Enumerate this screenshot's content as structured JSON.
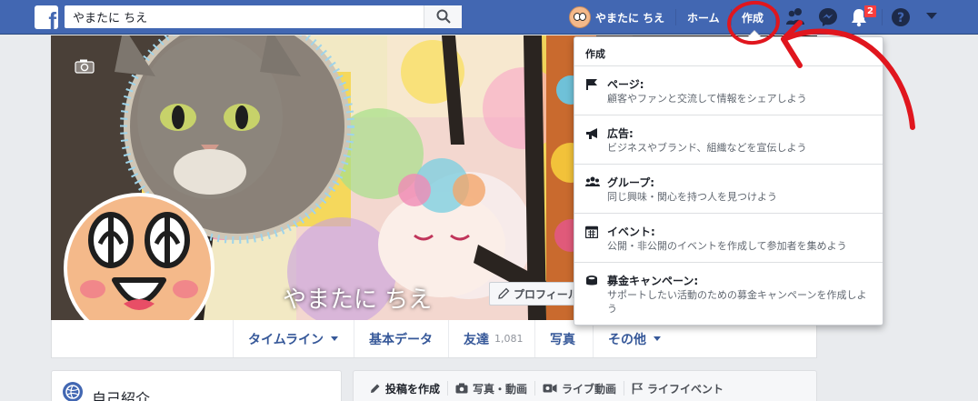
{
  "topbar": {
    "logo": "f",
    "search_value": "やまたに ちえ",
    "user_name": "やまたに ちえ",
    "nav_home": "ホーム",
    "nav_create": "作成",
    "notification_count": "2",
    "icons": [
      "search-icon",
      "friends-icon",
      "messenger-icon",
      "bell-icon",
      "help-icon",
      "caret-down-icon"
    ]
  },
  "profile": {
    "cover_name": "やまたに ちえ",
    "edit_profile_label": "プロフィールを編集"
  },
  "tabs": [
    {
      "label": "タイムライン",
      "has_caret": true
    },
    {
      "label": "基本データ"
    },
    {
      "label": "友達",
      "count": "1,081"
    },
    {
      "label": "写真"
    },
    {
      "label": "その他",
      "has_caret": true
    }
  ],
  "intro": {
    "title": "自己紹介"
  },
  "composer": {
    "items": [
      "投稿を作成",
      "写真・動画",
      "ライブ動画",
      "ライフイベント"
    ]
  },
  "create_menu": {
    "header": "作成",
    "items": [
      {
        "title": "ページ:",
        "desc": "顧客やファンと交流して情報をシェアしよう",
        "icon": "flag-icon"
      },
      {
        "title": "広告:",
        "desc": "ビジネスやブランド、組織などを宣伝しよう",
        "icon": "megaphone-icon"
      },
      {
        "title": "グループ:",
        "desc": "同じ興味・関心を持つ人を見つけよう",
        "icon": "group-icon"
      },
      {
        "title": "イベント:",
        "desc": "公開・非公開のイベントを作成して参加者を集めよう",
        "icon": "calendar-icon"
      },
      {
        "title": "募金キャンペーン:",
        "desc": "サポートしたい活動のための募金キャンペーンを作成しよう",
        "icon": "fundraiser-icon"
      }
    ]
  },
  "colors": {
    "brand_blue": "#4267b2",
    "link_blue": "#365899",
    "annotation_red": "#e0161e"
  }
}
